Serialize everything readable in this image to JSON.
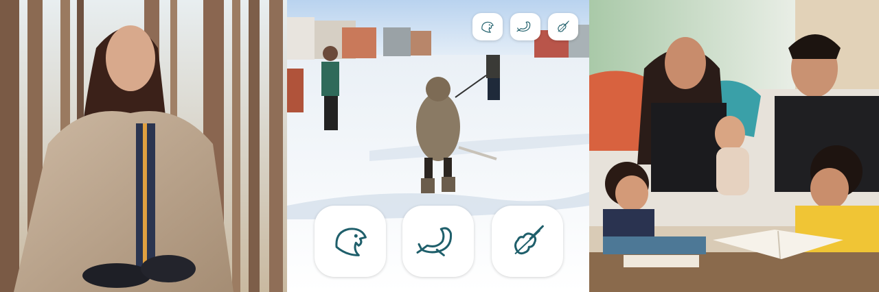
{
  "panels": [
    {
      "name": "woman-in-forest"
    },
    {
      "name": "child-playing-street-hockey"
    },
    {
      "name": "family-reading-together"
    }
  ],
  "badges": [
    {
      "name": "eagle-icon",
      "color": "#1f5f6b"
    },
    {
      "name": "whale-icon",
      "color": "#1f5f6b"
    },
    {
      "name": "fiddle-icon",
      "color": "#1f5f6b"
    }
  ],
  "colors": {
    "icon_teal": "#1f5f6b",
    "snow": "#f2f6fa",
    "sky": "#dbe9f7"
  }
}
